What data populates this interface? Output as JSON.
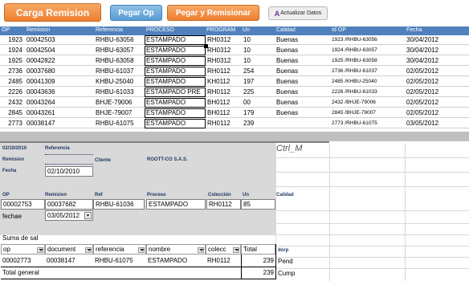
{
  "toolbar": {
    "carga_label": "Carga Remision",
    "pegar_label": "Pegar Op",
    "pegar_rem_label": "Pegar y Remisionar",
    "actualizar_label": "Actualizar Datos",
    "actualizar_icon": "A"
  },
  "table1": {
    "headers": [
      "OP",
      "Remision",
      "Referencia",
      "PROCESO",
      "PROGRAM",
      "Un",
      "Calidad",
      "Id OP",
      "Fecha"
    ],
    "rows": [
      [
        "1923",
        "00042503",
        "RHBU-63056",
        "ESTAMPADO",
        "RH0312",
        "10",
        "Buenas",
        "1923 /RHBU-63056",
        "30/04/2012"
      ],
      [
        "1924",
        "00042504",
        "RHBU-63057",
        "ESTAMPADO",
        "RH0312",
        "10",
        "Buenas",
        "1924 /RHBU-63057",
        "30/04/2012"
      ],
      [
        "1925",
        "00042822",
        "RHBU-63058",
        "ESTAMPADO",
        "RH0312",
        "10",
        "Buenas",
        "1925 /RHBU-63058",
        "30/04/2012"
      ],
      [
        "2736",
        "00037680",
        "RHBU-61037",
        "ESTAMPADO",
        "RH0112",
        "254",
        "Buenas",
        "2736 /RHBU-61037",
        "02/05/2012"
      ],
      [
        "2485",
        "00041309",
        "KHBU-25040",
        "ESTAMPADO",
        "KH0112",
        "197",
        "Buenas",
        "2485 /KHBU-25040",
        "02/05/2012"
      ],
      [
        "2226",
        "00043636",
        "RHBU-61033",
        "ESTAMPADO PRE",
        "RH0112",
        "225",
        "Buenas",
        "2226 /RHBU-61033",
        "02/05/2012"
      ],
      [
        "2432",
        "00043264",
        "BHJE-79006",
        "ESTAMPADO",
        "BH0112",
        "00",
        "Buenas",
        "2432 /BHJE-79006",
        "02/05/2012"
      ],
      [
        "2845",
        "00043261",
        "BHJE-79007",
        "ESTAMPADO",
        "BH0112",
        "179",
        "Buenas",
        "2845 /BHJE-79007",
        "02/05/2012"
      ],
      [
        "2773",
        "00038147",
        "RHBU-61075",
        "ESTAMPADO",
        "RH0112",
        "239",
        "",
        "2773 /RHBU-61075",
        "03/05/2012"
      ]
    ]
  },
  "form": {
    "date": "02/10/2010",
    "referencia_label": "Referencia",
    "remision_label": "Remision",
    "cliente_label": "Cliente",
    "cliente_value": "ROOTT-CO S.A.S.",
    "fecha_label": "Fecha",
    "fecha_value": "02/10/2010",
    "ctrl_label": "Ctrl_M",
    "headers": [
      "OP",
      "Remision",
      "Ref",
      "Proceso",
      "Colección",
      "Un",
      "Calidad"
    ],
    "op": "00002753",
    "remision": "00037682",
    "ref": "RHBU-61036",
    "proceso": "ESTAMPADO",
    "coleccion": "RH0112",
    "un": "85",
    "fechae_label": "fechae",
    "fechae_value": "03/05/2012"
  },
  "pivot": {
    "title": "Suma de sal",
    "headers": [
      "op",
      "document",
      "referencia",
      "nombre",
      "colecc",
      "Total"
    ],
    "row": [
      "00002773",
      "00038147",
      "RHBU-61075",
      "ESTAMPADO",
      "RH0112",
      "239"
    ],
    "total_label": "Total general",
    "total_value": "239",
    "side_header": "dorp",
    "side_values": [
      "Pend",
      "Cump"
    ]
  },
  "colors": {
    "header_blue": "#4f81bd",
    "button_orange": "#ee7f2d",
    "button_blue": "#5a9bd3"
  }
}
